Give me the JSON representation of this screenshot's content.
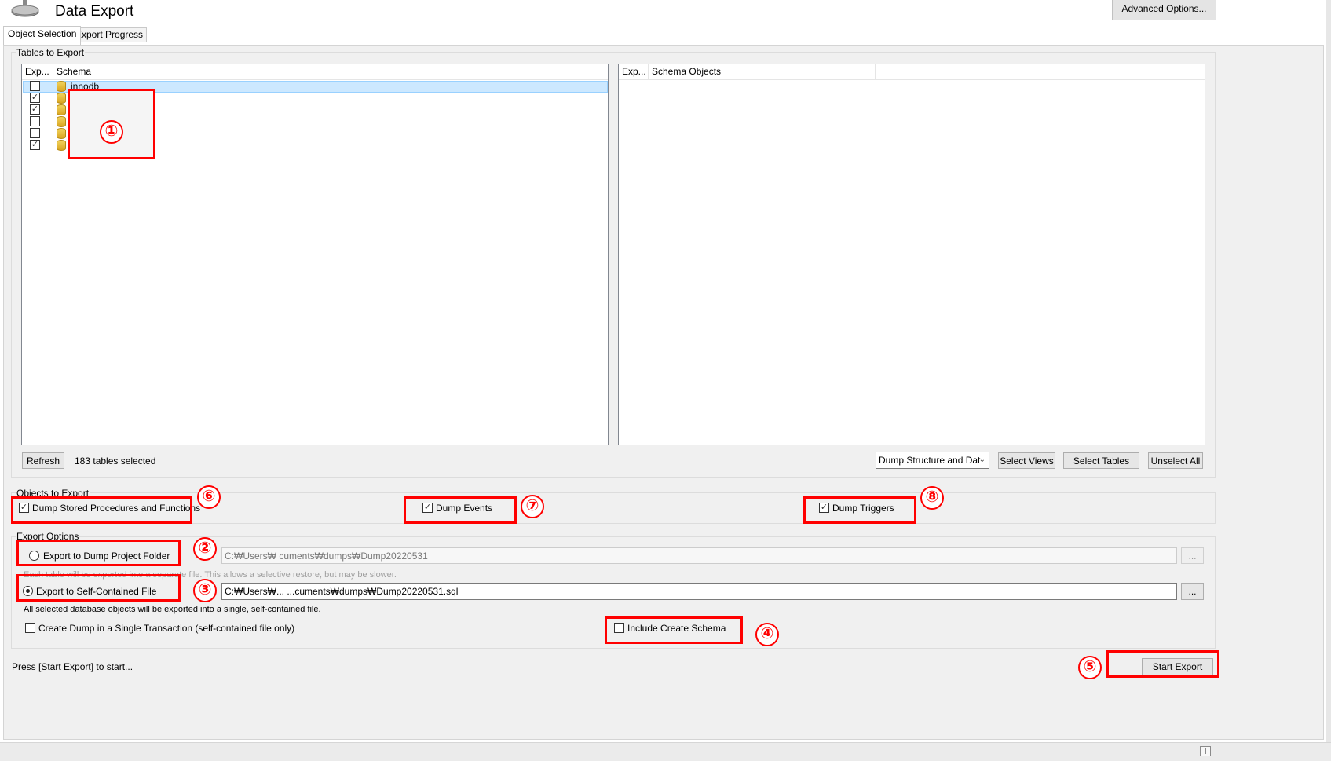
{
  "header": {
    "title": "Data Export",
    "advanced_label": "Advanced Options..."
  },
  "tabs": [
    {
      "label": "Object Selection",
      "active": true
    },
    {
      "label": "Export Progress",
      "active": false
    }
  ],
  "tables_group": {
    "label": "Tables to Export",
    "left_columns": [
      "Exp...",
      "Schema"
    ],
    "right_columns": [
      "Exp...",
      "Schema Objects"
    ],
    "schemas": [
      {
        "name": "innodb",
        "checked": false
      },
      {
        "name": "",
        "checked": true
      },
      {
        "name": "",
        "checked": true
      },
      {
        "name": "",
        "checked": false
      },
      {
        "name": "",
        "checked": false
      },
      {
        "name": "",
        "checked": true
      }
    ],
    "refresh_label": "Refresh",
    "selected_count": "183 tables selected",
    "dump_select_value": "Dump Structure and Dat",
    "select_views_label": "Select Views",
    "select_tables_label": "Select Tables",
    "unselect_all_label": "Unselect All"
  },
  "objects_group": {
    "label": "Objects to Export",
    "stored_procs_label": "Dump Stored Procedures and Functions",
    "events_label": "Dump Events",
    "triggers_label": "Dump Triggers"
  },
  "export_options": {
    "label": "Export Options",
    "folder_label": "Export to Dump Project Folder",
    "folder_path": "C:₩Users₩            cuments₩dumps₩Dump20220531",
    "folder_note": "Each table will be exported into a separate file. This allows a selective restore, but may be slower.",
    "file_label": "Export to Self-Contained File",
    "file_path": "C:₩Users₩... ...cuments₩dumps₩Dump20220531.sql",
    "file_note": "All selected database objects will be exported into a single, self-contained file.",
    "single_transaction_label": "Create Dump in a Single Transaction (self-contained file only)",
    "include_schema_label": "Include Create Schema",
    "browse_label": "..."
  },
  "footer": {
    "status": "Press [Start Export] to start...",
    "start_label": "Start Export"
  },
  "annotations": [
    "①",
    "②",
    "③",
    "④",
    "⑤",
    "⑥",
    "⑦",
    "⑧"
  ],
  "colors": {
    "annotation": "#ff0000",
    "selection": "#cce8ff",
    "panel": "#f0f0f0"
  }
}
